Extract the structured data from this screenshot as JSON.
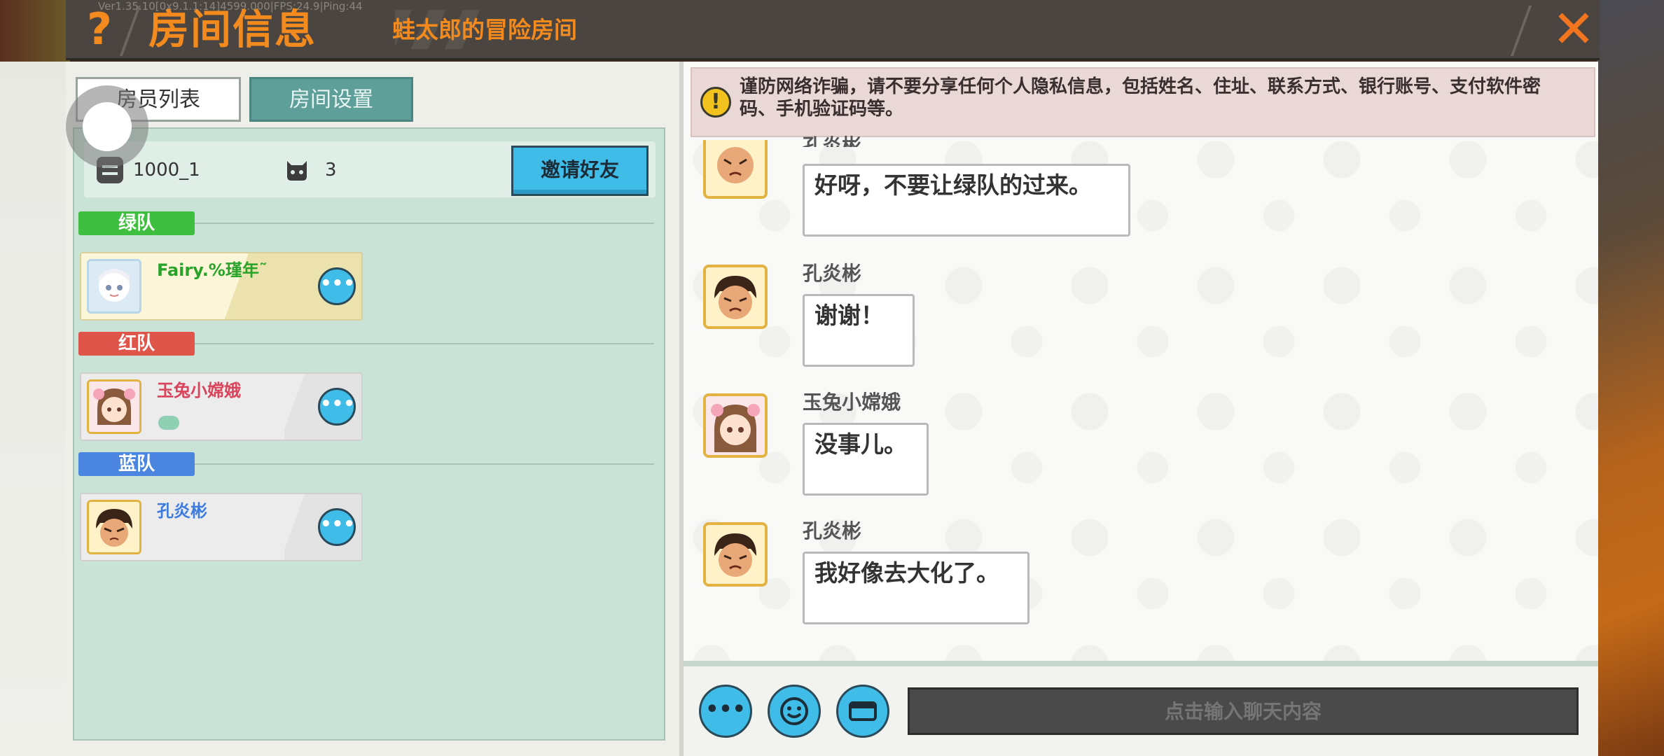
{
  "header": {
    "help_label": "?",
    "title": "房间信息",
    "room_name": "蛙太郎的冒险房间",
    "debug": "Ver1.35.10[0x9.1.1:14]4599.000|FPS:24.9|Ping:44",
    "close_label": "✕"
  },
  "tabs": [
    {
      "label": "房员列表"
    },
    {
      "label": "房间设置"
    }
  ],
  "room": {
    "id": "1000_1",
    "player_count": "3",
    "invite_label": "邀请好友"
  },
  "teams": [
    {
      "label": "绿队",
      "color": "#3fbf3f",
      "members": [
        {
          "name": "Fairy.%瑾年˜",
          "name_color": "#29a329",
          "more": "•••"
        }
      ]
    },
    {
      "label": "红队",
      "color": "#e0554a",
      "members": [
        {
          "name": "玉兔小嫦娥",
          "name_color": "#d9435b",
          "more": "•••"
        }
      ]
    },
    {
      "label": "蓝队",
      "color": "#4a86e0",
      "members": [
        {
          "name": "孔炎彬",
          "name_color": "#3d7be0",
          "more": "•••"
        }
      ]
    }
  ],
  "chat": {
    "warning": "谨防网络诈骗，请不要分享任何个人隐私信息，包括姓名、住址、联系方式、银行账号、支付软件密码、手机验证码等。",
    "messages": [
      {
        "sender": "孔炎彬",
        "text": "好呀，不要让绿队的过来。"
      },
      {
        "sender": "孔炎彬",
        "text": "谢谢！"
      },
      {
        "sender": "玉兔小嫦娥",
        "text": "没事儿。"
      },
      {
        "sender": "孔炎彬",
        "text": "我好像去大化了。"
      }
    ],
    "more_label": "•••",
    "input_placeholder": "点击输入聊天内容"
  }
}
